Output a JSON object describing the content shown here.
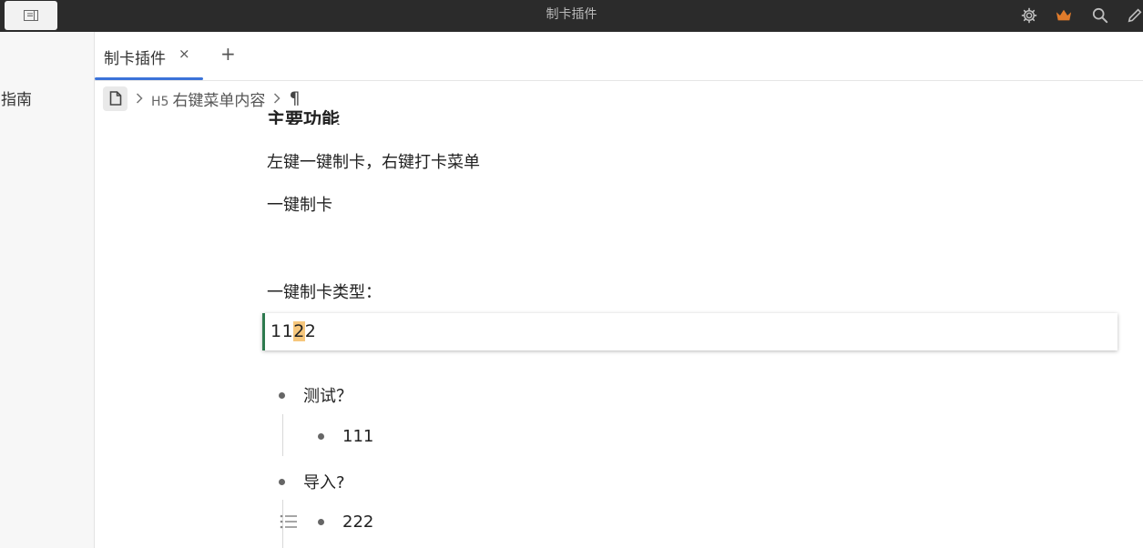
{
  "titlebar": {
    "title": "制卡插件",
    "icons": [
      "layout-icon",
      "gear-icon",
      "crown-icon",
      "search-icon",
      "pencil-icon"
    ],
    "crown_color": "#e07b2b"
  },
  "sidebar": {
    "items": [
      {
        "label": "指南"
      }
    ]
  },
  "tabs": {
    "items": [
      {
        "label": "制卡插件",
        "close": "×"
      }
    ],
    "add": "+",
    "accent": "#3b73d9"
  },
  "breadcrumb": {
    "heading_level": "H5",
    "heading_text": "右键菜单内容",
    "paragraph_mark": "¶"
  },
  "editor": {
    "cut_heading": "主要功能",
    "lines": [
      "左键一键制卡，右键打卡菜单",
      "一键制卡",
      "一键制卡类型："
    ],
    "card_block": {
      "text_before": "11",
      "highlighted": "2",
      "text_after": "2",
      "border_color": "#2d7a4e",
      "highlight_color": "#f7c77c"
    },
    "list": [
      {
        "label": "测试？",
        "children": [
          {
            "label": "111"
          }
        ]
      },
      {
        "label": "导入?",
        "children": [
          {
            "label": "222"
          }
        ]
      }
    ]
  }
}
